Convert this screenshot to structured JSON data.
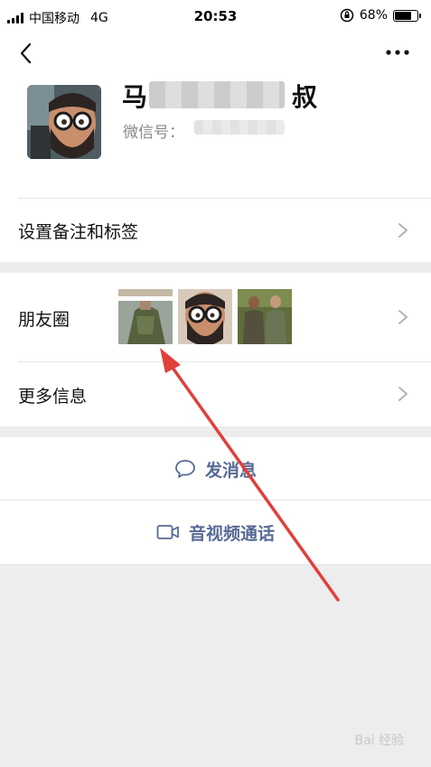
{
  "status_bar": {
    "carrier": "中国移动",
    "network": "4G",
    "time": "20:53",
    "battery_percent": "68%",
    "battery_level": 0.68
  },
  "profile": {
    "name_start": "马",
    "name_end": "叔",
    "wechat_id_label": "微信号：",
    "back_icon": "chevron-left-icon",
    "more_icon": "more-dots-icon"
  },
  "rows": {
    "remark": "设置备注和标签",
    "moments": "朋友圈",
    "more_info": "更多信息"
  },
  "actions": {
    "message": "发消息",
    "video_call": "音视频通话"
  },
  "colors": {
    "accent": "#576b95",
    "annotation_arrow": "#e0403a"
  },
  "watermark": "Bai 经验"
}
